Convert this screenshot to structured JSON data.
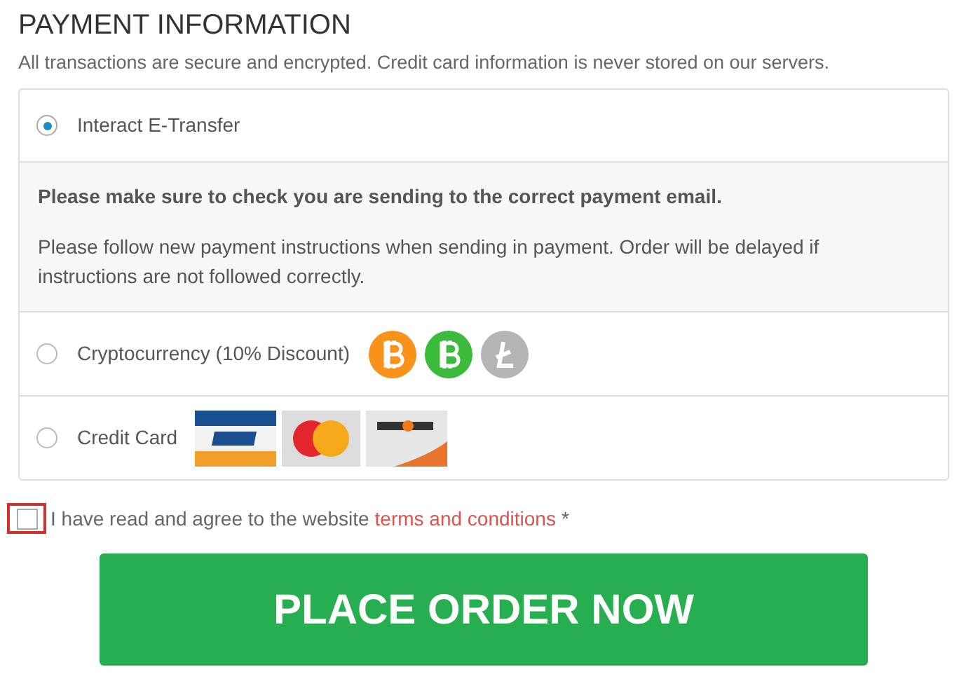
{
  "heading": "PAYMENT INFORMATION",
  "subtitle": "All transactions are secure and encrypted. Credit card information is never stored on our servers.",
  "methods": [
    {
      "label": "Interact E-Transfer",
      "selected": true,
      "details": {
        "warning": "Please make sure to check you are sending to the correct payment email.",
        "text": "Please follow new payment instructions when sending in payment. Order will be delayed if instructions are not followed correctly."
      }
    },
    {
      "label": "Cryptocurrency (10% Discount)",
      "selected": false,
      "logos": [
        {
          "kind": "coin",
          "color": "#f7931a"
        },
        {
          "kind": "coin",
          "color": "#3cba3c"
        },
        {
          "kind": "litecoin",
          "color": "#b5b5b5"
        }
      ]
    },
    {
      "label": "Credit Card",
      "selected": false,
      "logos": [
        {
          "kind": "card-blue"
        },
        {
          "kind": "card-circles"
        },
        {
          "kind": "card-swoosh"
        }
      ]
    }
  ],
  "agreement": {
    "checked": false,
    "text": "I have read and agree to the website",
    "link": "terms and conditions",
    "required_mark": "*"
  },
  "button": "PLACE ORDER NOW"
}
